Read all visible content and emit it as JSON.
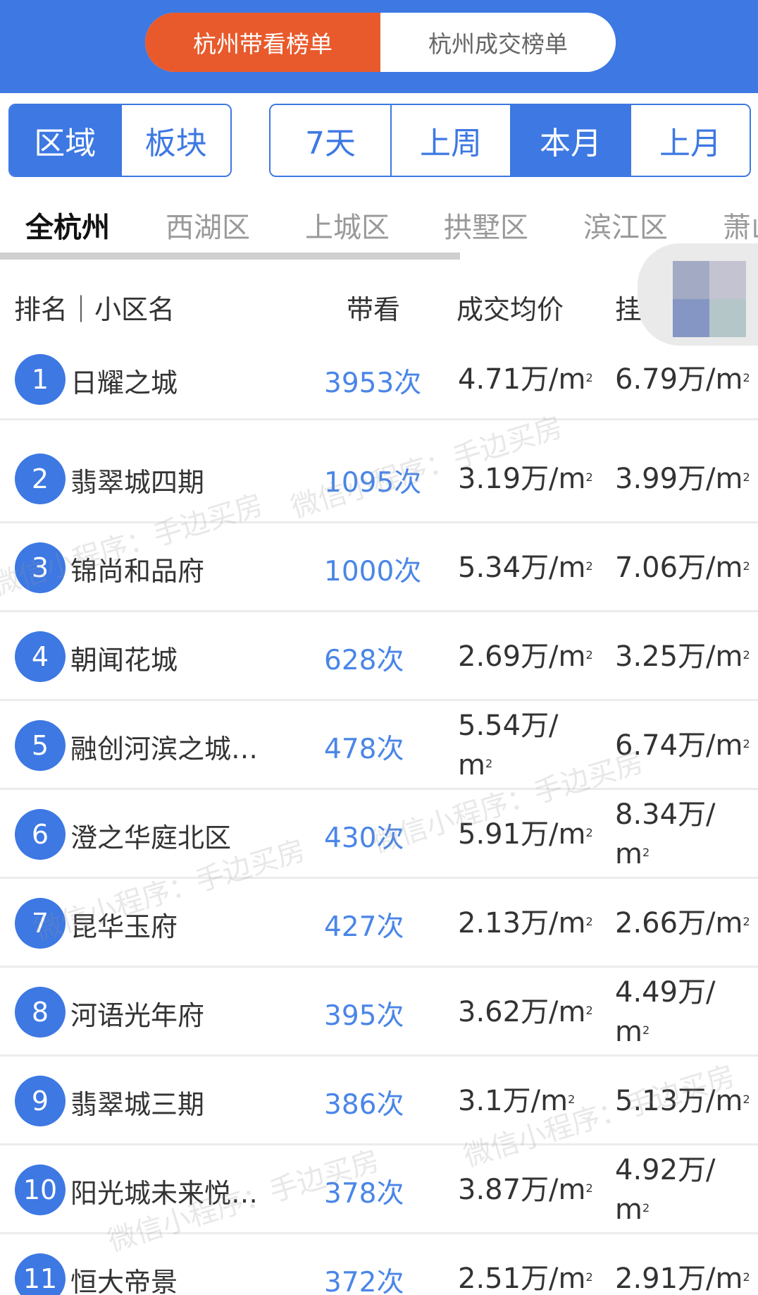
{
  "top_toggle": {
    "options": [
      {
        "label": "杭州带看榜单",
        "active": true
      },
      {
        "label": "杭州成交榜单",
        "active": false
      }
    ]
  },
  "filter_type": {
    "options": [
      {
        "label": "区域",
        "active": true
      },
      {
        "label": "板块",
        "active": false
      }
    ]
  },
  "filter_period": {
    "options": [
      {
        "label": "7天",
        "active": false
      },
      {
        "label": "上周",
        "active": false
      },
      {
        "label": "本月",
        "active": true
      },
      {
        "label": "上月",
        "active": false
      }
    ]
  },
  "districts": [
    {
      "label": "全杭州",
      "active": true
    },
    {
      "label": "西湖区",
      "active": false
    },
    {
      "label": "上城区",
      "active": false
    },
    {
      "label": "拱墅区",
      "active": false
    },
    {
      "label": "滨江区",
      "active": false
    },
    {
      "label": "萧山",
      "active": false
    }
  ],
  "table": {
    "headers": {
      "rank_name": "排名｜小区名",
      "visits": "带看",
      "avg_price": "成交均价",
      "list_price": "挂"
    },
    "unit": "万/m",
    "unit_sup": "2",
    "rows": [
      {
        "rank": "1",
        "name": "日耀之城",
        "visits": "3953次",
        "avg": "4.71",
        "list": "6.79"
      },
      {
        "rank": "2",
        "name": "翡翠城四期",
        "visits": "1095次",
        "avg": "3.19",
        "list": "3.99"
      },
      {
        "rank": "3",
        "name": "锦尚和品府",
        "visits": "1000次",
        "avg": "5.34",
        "list": "7.06"
      },
      {
        "rank": "4",
        "name": "朝闻花城",
        "visits": "628次",
        "avg": "2.69",
        "list": "3.25"
      },
      {
        "rank": "5",
        "name": "融创河滨之城…",
        "visits": "478次",
        "avg": "5.54",
        "list": "6.74"
      },
      {
        "rank": "6",
        "name": "澄之华庭北区",
        "visits": "430次",
        "avg": "5.91",
        "list": "8.34"
      },
      {
        "rank": "7",
        "name": "昆华玉府",
        "visits": "427次",
        "avg": "2.13",
        "list": "2.66"
      },
      {
        "rank": "8",
        "name": "河语光年府",
        "visits": "395次",
        "avg": "3.62",
        "list": "4.49"
      },
      {
        "rank": "9",
        "name": "翡翠城三期",
        "visits": "386次",
        "avg": "3.1",
        "list": "5.13"
      },
      {
        "rank": "10",
        "name": "阳光城未来悦…",
        "visits": "378次",
        "avg": "3.87",
        "list": "4.92"
      },
      {
        "rank": "11",
        "name": "恒大帝景",
        "visits": "372次",
        "avg": "2.51",
        "list": "2.91"
      }
    ]
  },
  "watermark": "微信小程序：手边买房"
}
